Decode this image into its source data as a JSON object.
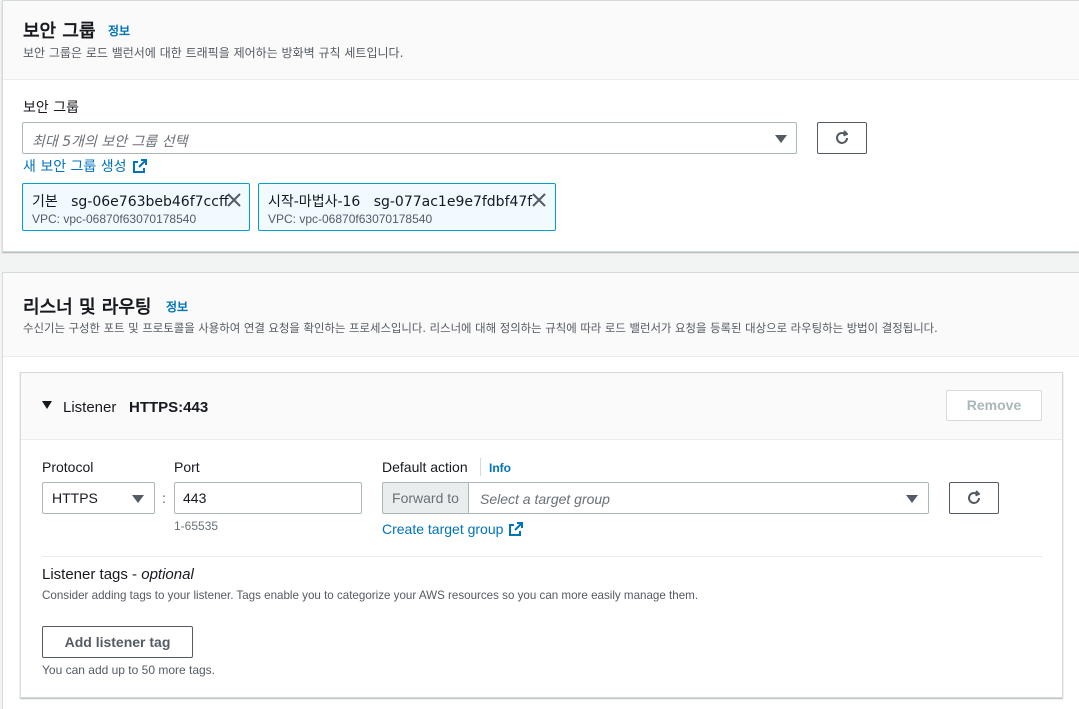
{
  "security_groups": {
    "title": "보안 그룹",
    "info_link": "정보",
    "description": "보안 그룹은 로드 밸런서에 대한 트래픽을 제어하는 방화벽 규칙 세트입니다.",
    "field_label": "보안 그룹",
    "select_placeholder": "최대 5개의 보안 그룹 선택",
    "create_link": "새 보안 그룹 생성",
    "tokens": [
      {
        "name": "기본",
        "id": "sg-06e763beb46f7ccff",
        "vpc": "VPC: vpc-06870f63070178540"
      },
      {
        "name": "시작-마법사-16",
        "id": "sg-077ac1e9e7fdbf47f",
        "vpc": "VPC: vpc-06870f63070178540"
      }
    ]
  },
  "listeners": {
    "title": "리스너 및 라우팅",
    "info_link": "정보",
    "description": "수신기는 구성한 포트 및 프로토콜을 사용하여 연결 요청을 확인하는 프로세스입니다. 리스너에 대해 정의하는 규칙에 따라 로드 밸런서가 요청을 등록된 대상으로 라우팅하는 방법이 결정됩니다.",
    "listener": {
      "label": "Listener",
      "name": "HTTPS:443",
      "remove_label": "Remove",
      "protocol_label": "Protocol",
      "protocol_value": "HTTPS",
      "port_label": "Port",
      "port_value": "443",
      "port_hint": "1-65535",
      "separator": ":",
      "default_action_label": "Default action",
      "default_action_info": "Info",
      "forward_to": "Forward to",
      "target_placeholder": "Select a target group",
      "create_target_link": "Create target group",
      "tags_title": "Listener tags",
      "tags_optional": "optional",
      "tags_description": "Consider adding tags to your listener. Tags enable you to categorize your AWS resources so you can more easily manage them.",
      "add_tag_label": "Add listener tag",
      "tags_limit": "You can add up to 50 more tags."
    }
  },
  "colors": {
    "link": "#0073bb",
    "token_border": "#00a1c9",
    "token_bg": "#f1faff"
  },
  "icons": [
    "refresh-icon",
    "external-link-icon",
    "close-icon",
    "caret-down-icon"
  ]
}
